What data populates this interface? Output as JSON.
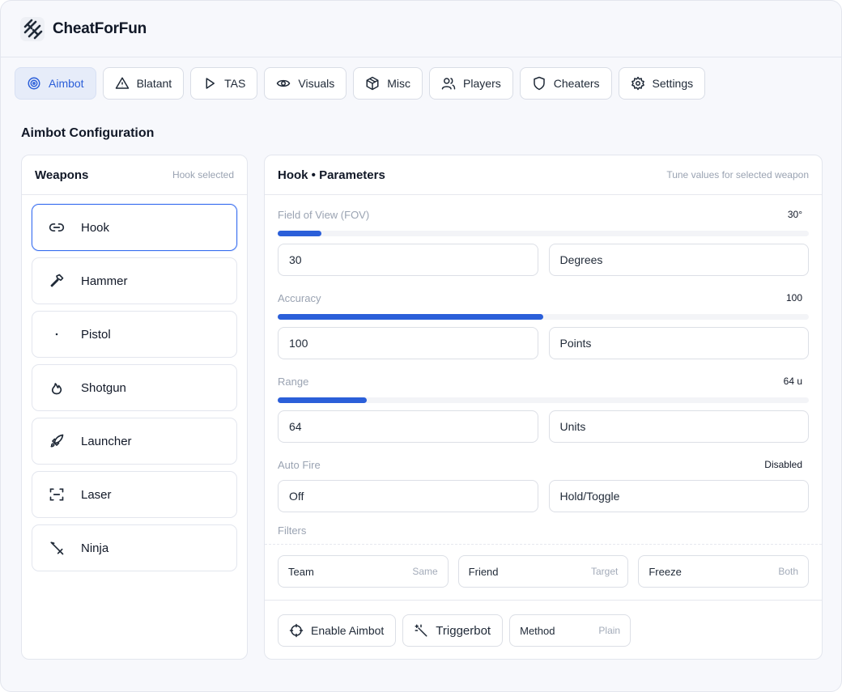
{
  "app": {
    "title": "CheatForFun",
    "accent": "#2b5fd9"
  },
  "tabs": [
    {
      "label": "Aimbot",
      "icon": "target-icon",
      "active": true
    },
    {
      "label": "Blatant",
      "icon": "warning-icon"
    },
    {
      "label": "TAS",
      "icon": "play-icon"
    },
    {
      "label": "Visuals",
      "icon": "eye-icon"
    },
    {
      "label": "Misc",
      "icon": "box-icon"
    },
    {
      "label": "Players",
      "icon": "users-icon"
    },
    {
      "label": "Cheaters",
      "icon": "shield-icon"
    },
    {
      "label": "Settings",
      "icon": "gear-icon"
    }
  ],
  "section_title": "Aimbot Configuration",
  "weapons": {
    "title": "Weapons",
    "hint": "Hook selected",
    "items": [
      {
        "label": "Hook",
        "icon": "link-icon",
        "selected": true
      },
      {
        "label": "Hammer",
        "icon": "hammer-icon"
      },
      {
        "label": "Pistol",
        "icon": "dot-icon"
      },
      {
        "label": "Shotgun",
        "icon": "flame-icon"
      },
      {
        "label": "Launcher",
        "icon": "rocket-icon"
      },
      {
        "label": "Laser",
        "icon": "scan-icon"
      },
      {
        "label": "Ninja",
        "icon": "sword-icon"
      }
    ]
  },
  "params": {
    "title": "Hook • Parameters",
    "hint": "Tune values for selected weapon",
    "fov": {
      "label": "Field of View (FOV)",
      "value": "30°",
      "level": 0.083,
      "input": "30",
      "unit": "Degrees"
    },
    "accuracy": {
      "label": "Accuracy",
      "value": "100",
      "level": 0.5,
      "input": "100",
      "unit": "Points"
    },
    "range": {
      "label": "Range",
      "value": "64 u",
      "level": 0.168,
      "input": "64",
      "unit": "Units"
    },
    "autofire": {
      "label": "Auto Fire",
      "value": "Disabled",
      "input": "Off",
      "mode": "Hold/Toggle"
    },
    "filters_label": "Filters",
    "filters": [
      {
        "label": "Team",
        "value": "Same"
      },
      {
        "label": "Friend",
        "value": "Target"
      },
      {
        "label": "Freeze",
        "value": "Both"
      }
    ]
  },
  "actions": {
    "enable": "Enable Aimbot",
    "trigger": "Triggerbot",
    "method_label": "Method",
    "method_value": "Plain"
  }
}
